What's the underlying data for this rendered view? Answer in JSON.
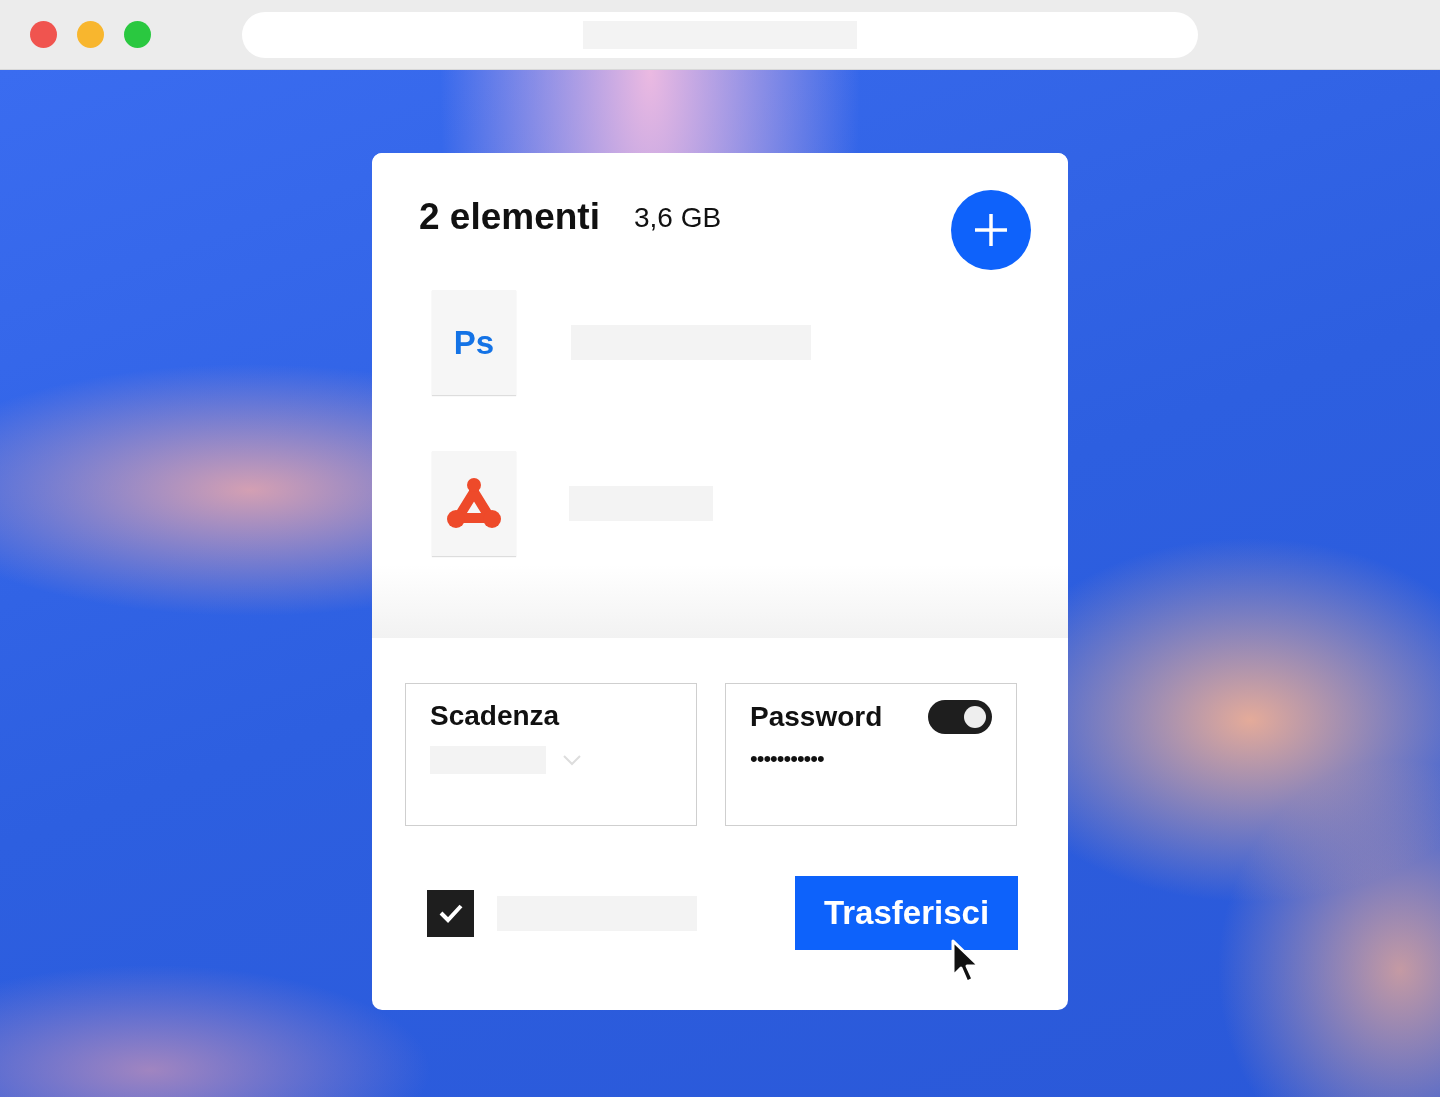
{
  "transfer": {
    "title": "2 elementi",
    "size": "3,6 GB",
    "files": [
      {
        "kind": "ps",
        "label": "Ps"
      },
      {
        "kind": "pdf"
      }
    ],
    "expiry": {
      "label": "Scadenza"
    },
    "password": {
      "label": "Password",
      "on": true,
      "value": "•••••••••••"
    },
    "agree": {
      "checked": true
    },
    "button": "Trasferisci"
  }
}
